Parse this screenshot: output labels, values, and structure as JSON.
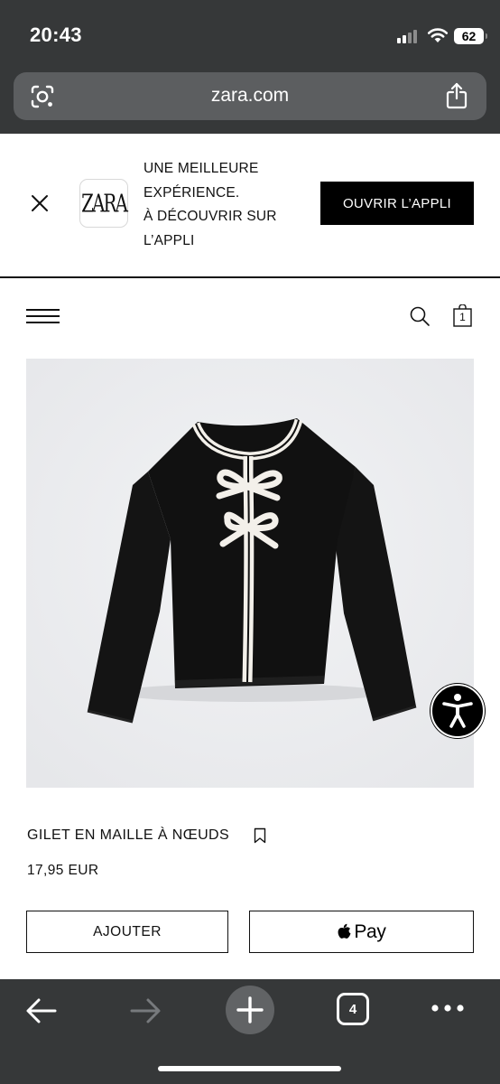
{
  "status_bar": {
    "time": "20:43",
    "battery": "62",
    "icons": [
      "signal-icon",
      "wifi-icon",
      "battery-icon"
    ]
  },
  "browser": {
    "url": "zara.com",
    "icons": [
      "lens-icon",
      "share-icon"
    ],
    "toolbar": {
      "tab_count": "4",
      "icons": [
        "back-arrow-icon",
        "forward-arrow-icon",
        "plus-icon",
        "tabs-icon",
        "more-icon"
      ]
    }
  },
  "banner": {
    "logo_text": "ZARA",
    "text_lines": [
      "UNE MEILLEURE",
      "EXPÉRIENCE.",
      "À DÉCOUVRIR SUR",
      "L’APPLI"
    ],
    "button_label": "OUVRIR L’APPLI"
  },
  "header": {
    "bag_count": "1",
    "icons": [
      "hamburger-menu-icon",
      "search-icon",
      "shopping-bag-icon"
    ]
  },
  "product": {
    "name": "GILET EN MAILLE À NŒUDS",
    "price": "17,95 EUR",
    "add_label": "AJOUTER",
    "pay_label": "Pay",
    "image_icon": "cardigan-photo",
    "accessibility_icon": "accessibility-icon"
  },
  "colors": {
    "browser_chrome": "#363839",
    "url_bar": "#5c5e60",
    "primary": "#000000",
    "product_bg": "#edeef0"
  }
}
